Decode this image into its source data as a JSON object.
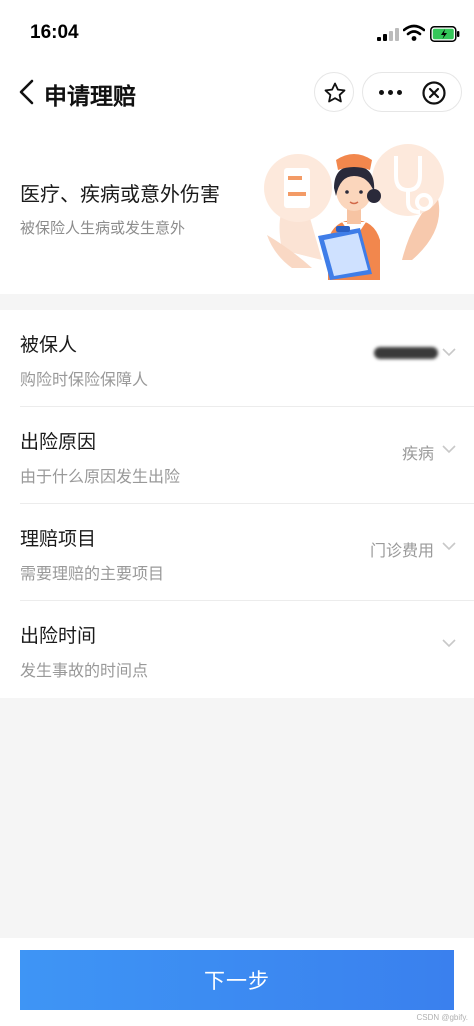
{
  "status_bar": {
    "time": "16:04"
  },
  "nav": {
    "title": "申请理赔",
    "icons": [
      "back-icon",
      "star-icon",
      "more-icon",
      "close-icon"
    ]
  },
  "banner": {
    "title": "医疗、疾病或意外伤害",
    "subtitle": "被保险人生病或发生意外",
    "illustration": "nurse-with-clipboard-illustration"
  },
  "form": {
    "rows": [
      {
        "label": "被保人",
        "hint": "购险时保险保障人",
        "value": ""
      },
      {
        "label": "出险原因",
        "hint": "由于什么原因发生出险",
        "value": "疾病"
      },
      {
        "label": "理赔项目",
        "hint": "需要理赔的主要项目",
        "value": "门诊费用"
      },
      {
        "label": "出险时间",
        "hint": "发生事故的时间点",
        "value": ""
      }
    ]
  },
  "footer": {
    "next_label": "下一步",
    "watermark": "CSDN @gbify."
  },
  "colors": {
    "primary": "#3a86f0",
    "hint": "#999999",
    "background": "#f5f5f5"
  }
}
